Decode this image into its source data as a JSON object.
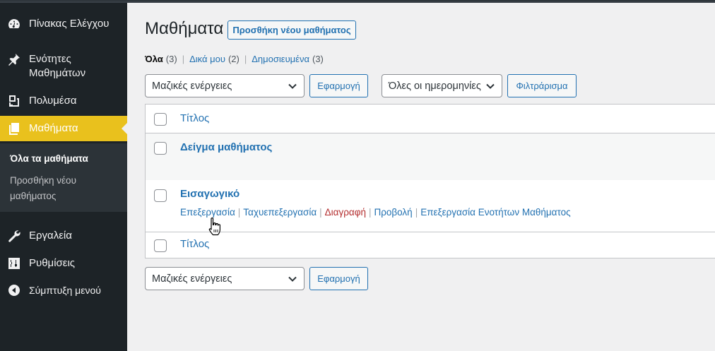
{
  "sidebar": {
    "items": [
      {
        "label": "Πίνακας Ελέγχου",
        "icon": "dashboard-icon"
      },
      {
        "label": "Ενότητες Μαθημάτων",
        "icon": "pin-icon"
      },
      {
        "label": "Πολυμέσα",
        "icon": "media-icon"
      },
      {
        "label": "Μαθήματα",
        "icon": "pages-icon",
        "active": true
      },
      {
        "label": "Εργαλεία",
        "icon": "wrench-icon"
      },
      {
        "label": "Ρυθμίσεις",
        "icon": "settings-icon"
      },
      {
        "label": "Σύμπτυξη μενού",
        "icon": "collapse-icon"
      }
    ],
    "submenu": [
      {
        "label": "Όλα τα μαθήματα",
        "current": true
      },
      {
        "label": "Προσθήκη νέου μαθήματος"
      }
    ]
  },
  "main": {
    "title": "Μαθήματα",
    "add_new": "Προσθήκη νέου μαθήματος",
    "views": [
      {
        "label": "Όλα",
        "count": "(3)",
        "current": true
      },
      {
        "label": "Δικά μου",
        "count": "(2)"
      },
      {
        "label": "Δημοσιευμένα",
        "count": "(3)"
      }
    ],
    "views_separator": "|",
    "bulk_actions": "Μαζικές ενέργειες",
    "apply": "Εφαρμογή",
    "dates": "Όλες οι ημερομηνίες",
    "filter": "Φιλτράρισμα",
    "table": {
      "column_title": "Τίτλος",
      "rows": [
        {
          "title": "Δείγμα μαθήματος"
        },
        {
          "title": "Εισαγωγικό",
          "actions": [
            "Επεξεργασία",
            "Ταχυεπεξεργασία",
            "Διαγραφή",
            "Προβολή",
            "Επεξεργασία Ενοτήτων Μαθήματος"
          ]
        }
      ]
    }
  },
  "colors": {
    "sidebar_bg": "#1d2327",
    "active_bg": "#e9c11d",
    "link": "#2271b1",
    "delete": "#b32d2e"
  }
}
